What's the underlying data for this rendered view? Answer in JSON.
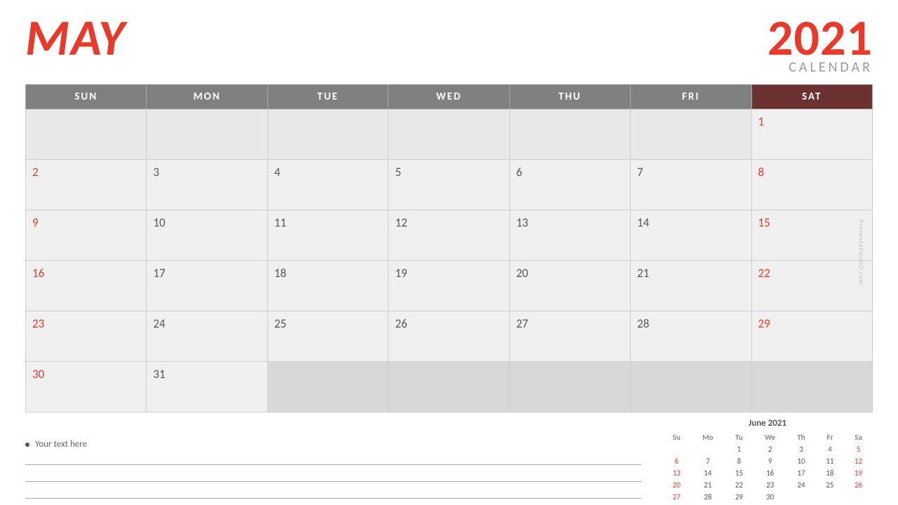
{
  "header": {
    "month": "MAY",
    "year": "2021",
    "calendar_label": "CALENDAR"
  },
  "weekdays": [
    {
      "label": "SUN",
      "is_sat": false
    },
    {
      "label": "MON",
      "is_sat": false
    },
    {
      "label": "TUE",
      "is_sat": false
    },
    {
      "label": "WED",
      "is_sat": false
    },
    {
      "label": "THU",
      "is_sat": false
    },
    {
      "label": "FRI",
      "is_sat": false
    },
    {
      "label": "SAT",
      "is_sat": true
    }
  ],
  "weeks": [
    [
      {
        "day": "",
        "type": "empty"
      },
      {
        "day": "",
        "type": "empty"
      },
      {
        "day": "",
        "type": "empty"
      },
      {
        "day": "",
        "type": "empty"
      },
      {
        "day": "",
        "type": "empty"
      },
      {
        "day": "",
        "type": "empty"
      },
      {
        "day": "1",
        "type": "weekend"
      }
    ],
    [
      {
        "day": "2",
        "type": "weekend"
      },
      {
        "day": "3",
        "type": "normal"
      },
      {
        "day": "4",
        "type": "normal"
      },
      {
        "day": "5",
        "type": "normal"
      },
      {
        "day": "6",
        "type": "normal"
      },
      {
        "day": "7",
        "type": "normal"
      },
      {
        "day": "8",
        "type": "weekend"
      }
    ],
    [
      {
        "day": "9",
        "type": "weekend"
      },
      {
        "day": "10",
        "type": "normal"
      },
      {
        "day": "11",
        "type": "normal"
      },
      {
        "day": "12",
        "type": "normal"
      },
      {
        "day": "13",
        "type": "normal"
      },
      {
        "day": "14",
        "type": "normal"
      },
      {
        "day": "15",
        "type": "weekend"
      }
    ],
    [
      {
        "day": "16",
        "type": "weekend"
      },
      {
        "day": "17",
        "type": "normal"
      },
      {
        "day": "18",
        "type": "normal"
      },
      {
        "day": "19",
        "type": "normal"
      },
      {
        "day": "20",
        "type": "normal"
      },
      {
        "day": "21",
        "type": "normal"
      },
      {
        "day": "22",
        "type": "weekend"
      }
    ],
    [
      {
        "day": "23",
        "type": "weekend"
      },
      {
        "day": "24",
        "type": "normal"
      },
      {
        "day": "25",
        "type": "normal"
      },
      {
        "day": "26",
        "type": "normal"
      },
      {
        "day": "27",
        "type": "normal"
      },
      {
        "day": "28",
        "type": "normal"
      },
      {
        "day": "29",
        "type": "weekend"
      }
    ],
    [
      {
        "day": "30",
        "type": "weekend"
      },
      {
        "day": "31",
        "type": "normal"
      },
      {
        "day": "",
        "type": "out-of-month"
      },
      {
        "day": "",
        "type": "out-of-month"
      },
      {
        "day": "",
        "type": "out-of-month"
      },
      {
        "day": "",
        "type": "out-of-month"
      },
      {
        "day": "",
        "type": "out-of-month"
      }
    ]
  ],
  "notes": {
    "bullet_text": "Your text here"
  },
  "mini_calendar": {
    "title": "June 2021",
    "headers": [
      "Su",
      "Mo",
      "Tu",
      "We",
      "Th",
      "Fr",
      "Sa"
    ],
    "weeks": [
      [
        {
          "day": "",
          "type": "normal"
        },
        {
          "day": "",
          "type": "normal"
        },
        {
          "day": "1",
          "type": "normal"
        },
        {
          "day": "2",
          "type": "normal"
        },
        {
          "day": "3",
          "type": "normal"
        },
        {
          "day": "4",
          "type": "normal"
        },
        {
          "day": "5",
          "type": "weekend"
        }
      ],
      [
        {
          "day": "6",
          "type": "weekend"
        },
        {
          "day": "7",
          "type": "normal"
        },
        {
          "day": "8",
          "type": "normal"
        },
        {
          "day": "9",
          "type": "normal"
        },
        {
          "day": "10",
          "type": "normal"
        },
        {
          "day": "11",
          "type": "normal"
        },
        {
          "day": "12",
          "type": "weekend"
        }
      ],
      [
        {
          "day": "13",
          "type": "weekend"
        },
        {
          "day": "14",
          "type": "normal"
        },
        {
          "day": "15",
          "type": "normal"
        },
        {
          "day": "16",
          "type": "normal"
        },
        {
          "day": "17",
          "type": "normal"
        },
        {
          "day": "18",
          "type": "normal"
        },
        {
          "day": "19",
          "type": "weekend"
        }
      ],
      [
        {
          "day": "20",
          "type": "weekend"
        },
        {
          "day": "21",
          "type": "normal"
        },
        {
          "day": "22",
          "type": "normal"
        },
        {
          "day": "23",
          "type": "normal"
        },
        {
          "day": "24",
          "type": "normal"
        },
        {
          "day": "25",
          "type": "normal"
        },
        {
          "day": "26",
          "type": "weekend"
        }
      ],
      [
        {
          "day": "27",
          "type": "weekend"
        },
        {
          "day": "28",
          "type": "normal"
        },
        {
          "day": "29",
          "type": "normal"
        },
        {
          "day": "30",
          "type": "normal"
        },
        {
          "day": "",
          "type": "normal"
        },
        {
          "day": "",
          "type": "normal"
        },
        {
          "day": "",
          "type": "normal"
        }
      ]
    ]
  },
  "watermark": "PresentationGO.com"
}
